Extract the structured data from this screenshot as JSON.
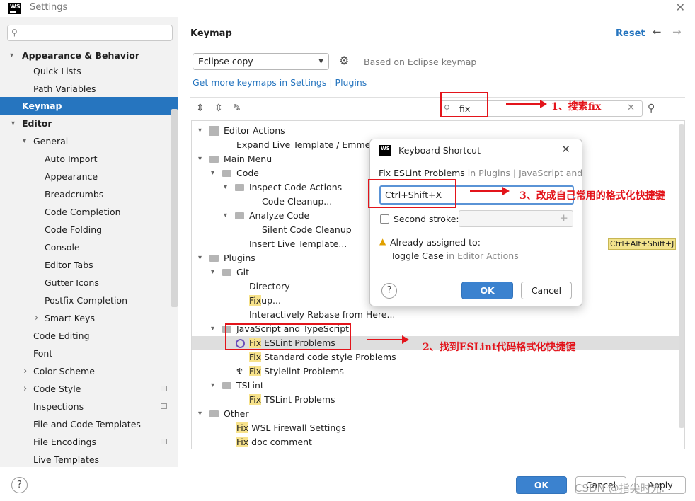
{
  "window": {
    "title": "Settings",
    "logo": "WS"
  },
  "sidebar": {
    "search_placeholder": "",
    "items": [
      {
        "label": "Appearance & Behavior",
        "chevron": "▾"
      },
      {
        "label": "Quick Lists"
      },
      {
        "label": "Path Variables"
      },
      {
        "label": "Keymap"
      },
      {
        "label": "Editor",
        "chevron": "▾"
      },
      {
        "label": "General",
        "chevron": "▾"
      },
      {
        "label": "Auto Import"
      },
      {
        "label": "Appearance"
      },
      {
        "label": "Breadcrumbs"
      },
      {
        "label": "Code Completion"
      },
      {
        "label": "Code Folding"
      },
      {
        "label": "Console"
      },
      {
        "label": "Editor Tabs"
      },
      {
        "label": "Gutter Icons"
      },
      {
        "label": "Postfix Completion"
      },
      {
        "label": "Smart Keys",
        "chevron": "›"
      },
      {
        "label": "Code Editing"
      },
      {
        "label": "Font"
      },
      {
        "label": "Color Scheme",
        "chevron": "›"
      },
      {
        "label": "Code Style",
        "chevron": "›"
      },
      {
        "label": "Inspections"
      },
      {
        "label": "File and Code Templates"
      },
      {
        "label": "File Encodings"
      },
      {
        "label": "Live Templates"
      }
    ]
  },
  "main": {
    "breadcrumb": "Keymap",
    "reset_label": "Reset",
    "keymap_select": "Eclipse copy",
    "based_on": "Based on Eclipse keymap",
    "plugins_link": "Get more keymaps in Settings | Plugins",
    "filter_value": "fix"
  },
  "tree": {
    "rows": [
      {
        "label": "Editor Actions"
      },
      {
        "label": "Expand Live Template / Emmet Abbreviation"
      },
      {
        "label": "Main Menu"
      },
      {
        "label": "Code"
      },
      {
        "label": "Inspect Code Actions"
      },
      {
        "label": "Code Cleanup..."
      },
      {
        "label": "Analyze Code"
      },
      {
        "label": "Silent Code Cleanup"
      },
      {
        "label": "Insert Live Template...",
        "shortcut": "Ctrl+Alt+Shift+J"
      },
      {
        "label": "Plugins"
      },
      {
        "label": "Git"
      },
      {
        "label": "Directory"
      },
      {
        "label": "up...",
        "prefix": "Fix"
      },
      {
        "label": "Interactively Rebase from Here..."
      },
      {
        "label": "JavaScript and TypeScript"
      },
      {
        "label": "ESLint Problems",
        "prefix": "Fix"
      },
      {
        "label": "Standard code style Problems",
        "prefix": "Fix"
      },
      {
        "label": "Stylelint Problems",
        "prefix": "Fix"
      },
      {
        "label": "TSLint"
      },
      {
        "label": "TSLint Problems",
        "prefix": "Fix"
      },
      {
        "label": "Other"
      },
      {
        "label": "WSL Firewall Settings",
        "prefix": "Fix"
      },
      {
        "label": "doc comment",
        "prefix": "Fix"
      }
    ]
  },
  "dialog": {
    "title": "Keyboard Shortcut",
    "logo": "WS",
    "action_name": "Fix ESLint Problems",
    "action_context": " in Plugins | JavaScript and TypeScript",
    "shortcut_value": "Ctrl+Shift+X",
    "second_stroke_label": "Second stroke:",
    "assigned_label": "Already assigned to:",
    "assigned_action": "Toggle Case",
    "assigned_context": " in Editor Actions",
    "ok_label": "OK",
    "cancel_label": "Cancel"
  },
  "footer": {
    "ok_label": "OK",
    "cancel_label": "Cancel",
    "apply_label": "Apply"
  },
  "annotations": {
    "step1": "1、搜索fix",
    "step2": "2、找到ESLint代码格式化快捷键",
    "step3": "3、改成自己常用的格式化快捷键",
    "color": "#e3141b"
  },
  "watermark": "CSDN @指尖时光."
}
